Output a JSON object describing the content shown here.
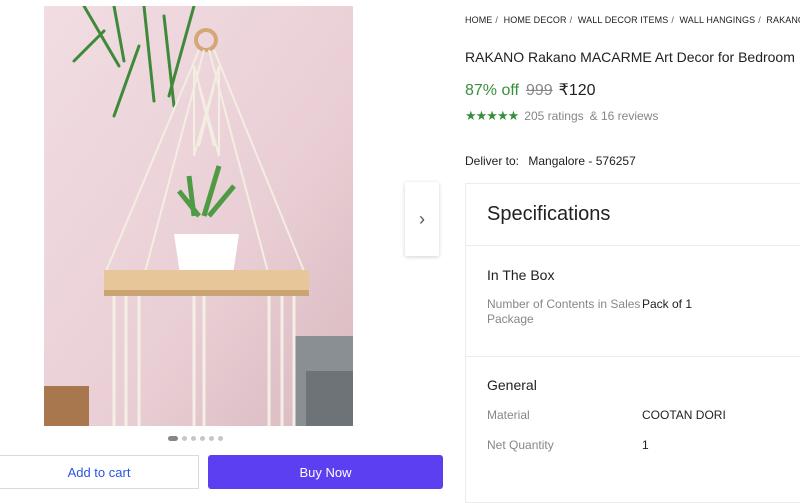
{
  "breadcrumb": [
    "HOME",
    "HOME DECOR",
    "WALL DECOR ITEMS",
    "WALL HANGINGS",
    "RAKANO WALL"
  ],
  "product": {
    "title": "RAKANO Rakano MACARME Art Decor for Bedroom",
    "discount": "87% off",
    "mrp": "999",
    "price": "₹120",
    "stars": "★★★★★",
    "rating_value": 4.5,
    "ratings": "205 ratings",
    "reviews": "& 16 reviews"
  },
  "delivery": {
    "label": "Deliver to:",
    "location": "Mangalore - 576257"
  },
  "carousel": {
    "next_icon": "›",
    "dot_count": 6,
    "active_index": 0
  },
  "actions": {
    "add_to_cart": "Add to cart",
    "buy_now": "Buy Now"
  },
  "specifications": {
    "heading": "Specifications",
    "sections": [
      {
        "title": "In The Box",
        "rows": [
          {
            "key": "Number of Contents in Sales Package",
            "value": "Pack of 1"
          }
        ]
      },
      {
        "title": "General",
        "rows": [
          {
            "key": "Material",
            "value": "COOTAN DORI"
          },
          {
            "key": "Net Quantity",
            "value": "1"
          }
        ]
      }
    ]
  },
  "colors": {
    "green": "#388e3c",
    "buy_button": "#5b3ff0",
    "cart_text": "#2a55e5"
  }
}
